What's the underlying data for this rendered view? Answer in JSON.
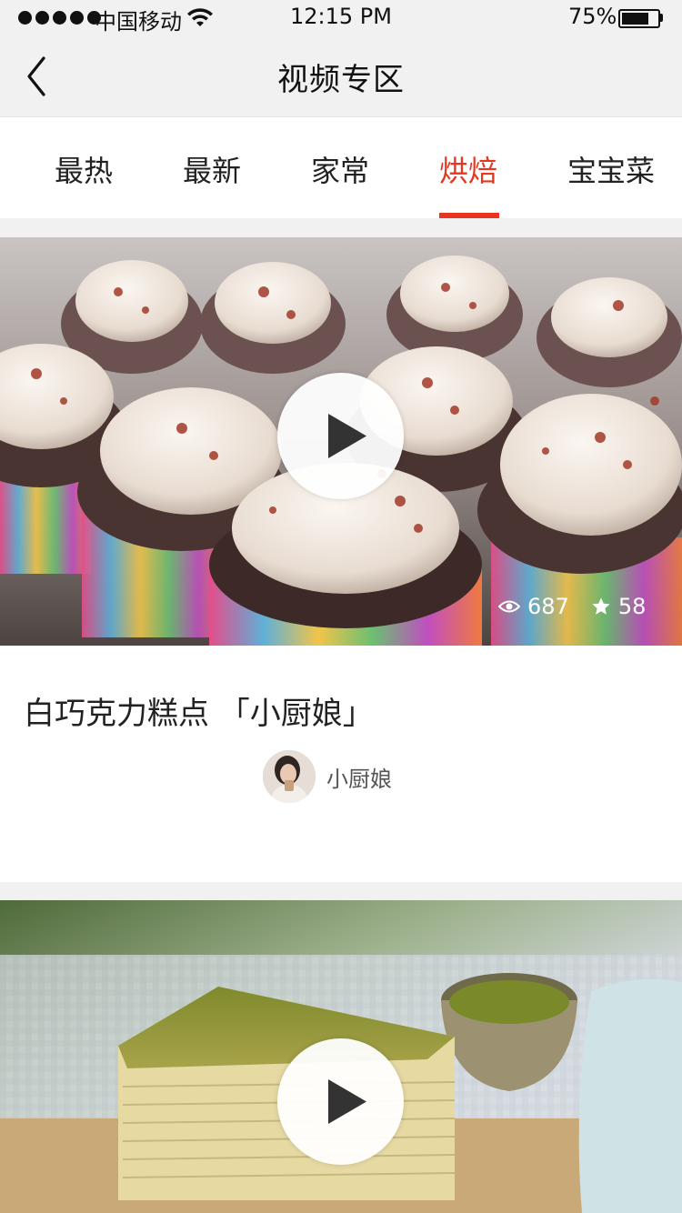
{
  "status_bar": {
    "carrier": "中国移动",
    "time": "12:15 PM",
    "battery_text": "75%",
    "battery_level": 0.75,
    "signal_bars": 5,
    "icons": [
      "signal-dots-icon",
      "wifi-icon",
      "battery-icon"
    ]
  },
  "nav": {
    "title": "视频专区",
    "back_icon": "chevron-left-icon"
  },
  "tabs": [
    {
      "label": "最热",
      "active": false
    },
    {
      "label": "最新",
      "active": false
    },
    {
      "label": "家常",
      "active": false
    },
    {
      "label": "烘焙",
      "active": true
    },
    {
      "label": "宝宝菜",
      "active": false
    }
  ],
  "colors": {
    "accent": "#e8351f",
    "background": "#f2f1f1",
    "card": "#ffffff",
    "text": "#222222"
  },
  "videos": [
    {
      "title": "白巧克力糕点 「小厨娘」",
      "views": "687",
      "favorites": "58",
      "author": "小厨娘",
      "view_icon": "eye-icon",
      "favorite_icon": "star-icon",
      "play_icon": "play-icon"
    },
    {
      "play_icon": "play-icon"
    }
  ]
}
